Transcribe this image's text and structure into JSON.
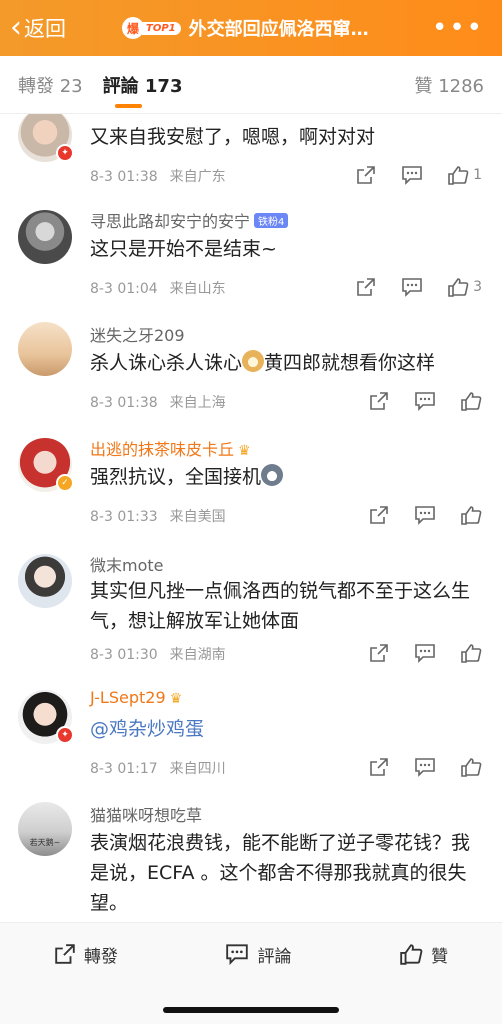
{
  "header": {
    "back_label": "返回",
    "hot_icon_text": "爆",
    "top_badge": "TOP1",
    "title": "外交部回应佩洛西窜…",
    "more_label": "•••"
  },
  "tabs": {
    "repost": "轉發 23",
    "comments": "評論 173",
    "likes": "贊 1286"
  },
  "comments": [
    {
      "username": "",
      "text": "又来自我安慰了，嗯嗯，啊对对对",
      "time": "8-3 01:38",
      "source": "来自广东",
      "likes": "1"
    },
    {
      "username": "寻思此路却安宁的安宁",
      "fan_badge": "铁粉4",
      "text": "这只是开始不是结束~",
      "time": "8-3 01:04",
      "source": "来自山东",
      "likes": "3"
    },
    {
      "username": "迷失之牙209",
      "text_before": "杀人诛心杀人诛心",
      "text_after": "黄四郎就想看你这样",
      "time": "8-3 01:38",
      "source": "来自上海",
      "likes": ""
    },
    {
      "username": "出逃的抹茶味皮卡丘",
      "text": "强烈抗议，全国接机",
      "time": "8-3 01:33",
      "source": "来自美国",
      "likes": ""
    },
    {
      "username": "微末mote",
      "text": "其实但凡挫一点佩洛西的锐气都不至于这么生气，想让解放军让她体面",
      "time": "8-3 01:30",
      "source": "来自湖南",
      "likes": ""
    },
    {
      "username": "J-LSept29",
      "text": "@鸡杂炒鸡蛋",
      "time": "8-3 01:17",
      "source": "来自四川",
      "likes": ""
    },
    {
      "username": "猫猫咪呀想吃草",
      "avatar_caption": "若天鹅~",
      "text": "表演烟花浪费钱，能不能断了逆子零花钱？我是说，ECFA 。这个都舍不得那我就真的很失望。"
    }
  ],
  "bottom_bar": {
    "repost": "轉發",
    "comment": "評論",
    "like": "贊"
  },
  "colors": {
    "header_orange": "#ff8c1a",
    "accent": "#ff8200",
    "vip_name": "#f07818",
    "mention": "#4a78c2"
  }
}
